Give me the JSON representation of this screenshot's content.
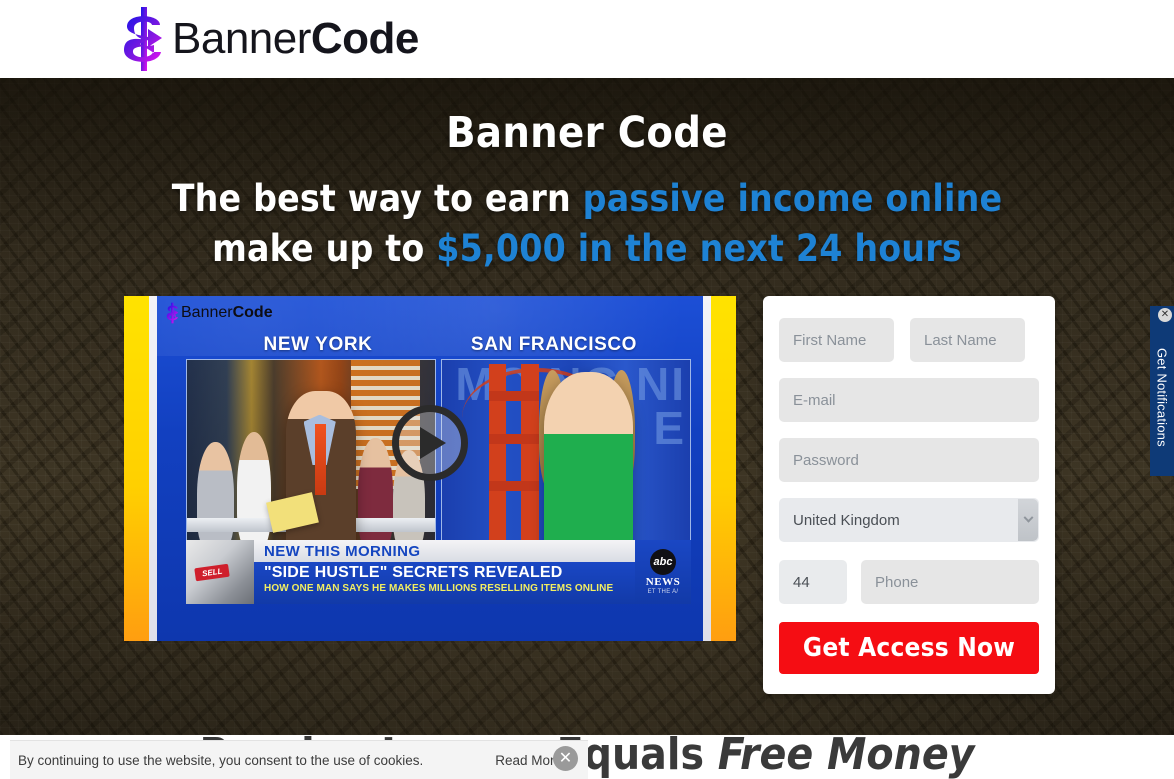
{
  "header": {
    "logo": {
      "icon": "dollar-sign-logo-icon",
      "text_light": "Banner",
      "text_bold": "Code"
    }
  },
  "hero": {
    "title": "Banner Code",
    "subline1_plain": "The best way to earn ",
    "subline1_highlight": "passive income online",
    "subline2_plain": "make up to ",
    "subline2_highlight": "$5,000 in the next 24 hours",
    "highlight_color": "#1e82d4",
    "background_color": "#382f1e"
  },
  "video": {
    "overlay_logo_light": "Banner",
    "overlay_logo_bold": "Code",
    "city_left": "NEW YORK",
    "city_right": "SAN FRANCISCO",
    "play_button": "play-button",
    "thumb_badge": "SELL",
    "ticker_kicker": "NEW THIS MORNING",
    "ticker_headline": "\"SIDE HUSTLE\" SECRETS REVEALED",
    "ticker_sub": "HOW ONE MAN SAYS HE MAKES MILLIONS RESELLING ITEMS ONLINE",
    "network_logo": "abc",
    "network_name": "NEWS",
    "network_affiliate": "ET THE A/",
    "sf_backdrop_text": "MO NG NI E"
  },
  "form": {
    "first_name_placeholder": "First Name",
    "first_name_value": "",
    "last_name_placeholder": "Last Name",
    "last_name_value": "",
    "email_placeholder": "E-mail",
    "email_value": "",
    "password_placeholder": "Password",
    "password_value": "",
    "country_selected": "United Kingdom",
    "country_options": [
      "United Kingdom"
    ],
    "country_chevron": "chevron-down-icon",
    "country_code_value": "44",
    "country_code_placeholder": "44",
    "phone_placeholder": "Phone",
    "phone_value": "",
    "submit_label": "Get Access Now",
    "submit_color": "#f50d13"
  },
  "below_hero": {
    "heading_plain": "Passive Income Equals ",
    "heading_italic": "Free Money"
  },
  "cookie_bar": {
    "message": "By continuing to use the website, you consent to the use of cookies.",
    "read_more_label": "Read More",
    "close_icon": "close-icon",
    "close_glyph": "✕"
  },
  "notification_tab": {
    "label": "Get Notifications",
    "close_glyph": "✕",
    "background_color": "#0e3a77"
  }
}
